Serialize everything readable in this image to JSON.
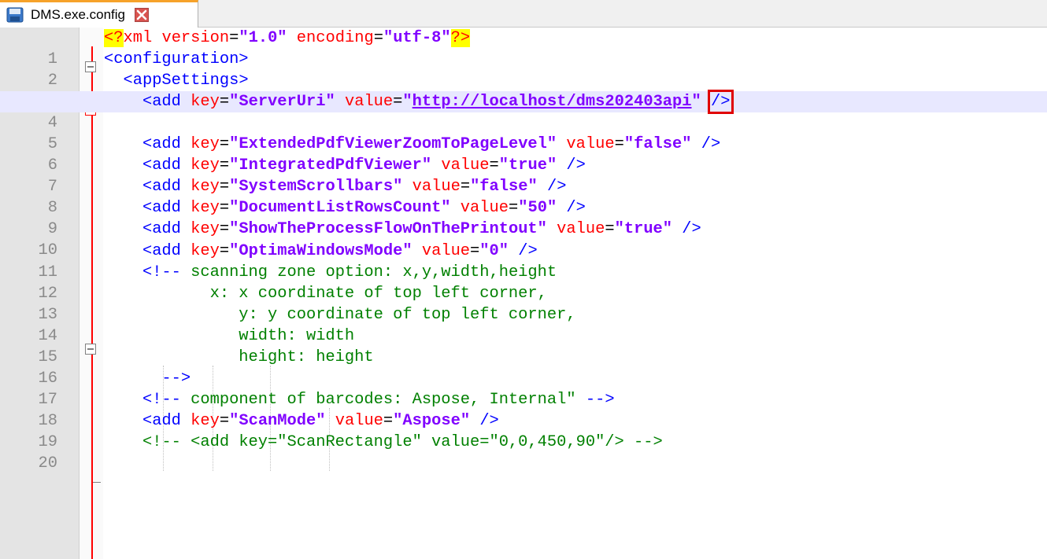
{
  "tab": {
    "title": "DMS.exe.config",
    "save_icon": "save-icon",
    "close_icon": "close-icon"
  },
  "colors": {
    "tag": "#0000ff",
    "attribute": "#ff0000",
    "value": "#8000ff",
    "comment": "#008000",
    "current_line": "#e8e8ff",
    "fold_line": "#ff0000",
    "tab_accent": "#f6a22a",
    "highlight_box": "#e00000"
  },
  "editor": {
    "line_numbers": [
      "1",
      "2",
      "3",
      "4",
      "5",
      "6",
      "7",
      "8",
      "9",
      "10",
      "11",
      "12",
      "13",
      "14",
      "15",
      "16",
      "17",
      "18",
      "19",
      "20"
    ],
    "current_line": 4,
    "lines": {
      "l1": {
        "open": "<",
        "q1": "?",
        "name": "xml ",
        "a1": "version",
        "eq1": "=",
        "v1": "\"1.0\"",
        "sp": " ",
        "a2": "encoding",
        "eq2": "=",
        "v2": "\"utf-8\"",
        "q2": "?>"
      },
      "l2": {
        "tag": "<configuration>"
      },
      "l3": {
        "indent": "  ",
        "tag": "<appSettings>"
      },
      "l4": {
        "indent": "    ",
        "tag": "<add ",
        "k": "key",
        "eq1": "=",
        "kv": "\"ServerUri\"",
        "sp": " ",
        "v": "value",
        "eq2": "=",
        "q1": "\"",
        "url": "http://localhost/dms202403api",
        "q2": "\"",
        "sp2": " ",
        "close": "/>"
      },
      "l6": {
        "indent": "    ",
        "tag": "<add ",
        "k": "key",
        "eq1": "=",
        "kv": "\"ExtendedPdfViewerZoomToPageLevel\"",
        "sp": " ",
        "v": "value",
        "eq2": "=",
        "vv": "\"false\"",
        "close": " />"
      },
      "l7": {
        "indent": "    ",
        "tag": "<add ",
        "k": "key",
        "eq1": "=",
        "kv": "\"IntegratedPdfViewer\"",
        "sp": " ",
        "v": "value",
        "eq2": "=",
        "vv": "\"true\"",
        "close": " />"
      },
      "l8": {
        "indent": "    ",
        "tag": "<add ",
        "k": "key",
        "eq1": "=",
        "kv": "\"SystemScrollbars\"",
        "sp": " ",
        "v": "value",
        "eq2": "=",
        "vv": "\"false\"",
        "close": " />"
      },
      "l9": {
        "indent": "    ",
        "tag": "<add ",
        "k": "key",
        "eq1": "=",
        "kv": "\"DocumentListRowsCount\"",
        "sp": " ",
        "v": "value",
        "eq2": "=",
        "vv": "\"50\"",
        "close": " />"
      },
      "l10": {
        "indent": "    ",
        "tag": "<add ",
        "k": "key",
        "eq1": "=",
        "kv": "\"ShowTheProcessFlowOnThePrintout\"",
        "sp": " ",
        "v": "value",
        "eq2": "=",
        "vv": "\"true\"",
        "close": " />"
      },
      "l11": {
        "indent": "    ",
        "tag": "<add ",
        "k": "key",
        "eq1": "=",
        "kv": "\"OptimaWindowsMode\"",
        "sp": " ",
        "v": "value",
        "eq2": "=",
        "vv": "\"0\"",
        "close": " />"
      },
      "l12": {
        "indent": "    ",
        "tag": "<!--",
        "text": " scanning zone option: x,y,width,height"
      },
      "l13": {
        "text": "           x: x coordinate of top left corner,"
      },
      "l14": {
        "text": "              y: y coordinate of top left corner,"
      },
      "l15": {
        "text": "              width: width"
      },
      "l16": {
        "text": "              height: height"
      },
      "l17": {
        "indent": "      ",
        "tag": "-->"
      },
      "l18": {
        "indent": "    ",
        "tag": "<!--",
        "text": " component of barcodes: Aspose, Internal\" ",
        "end": "-->"
      },
      "l19": {
        "indent": "    ",
        "tag": "<add ",
        "k": "key",
        "eq1": "=",
        "kv": "\"ScanMode\"",
        "sp": " ",
        "v": "value",
        "eq2": "=",
        "vv": "\"Aspose\"",
        "close": " />"
      },
      "l20": {
        "indent": "    ",
        "text": "<!-- <add key=\"ScanRectangle\" value=\"0,0,450,90\"/> -->"
      }
    }
  }
}
